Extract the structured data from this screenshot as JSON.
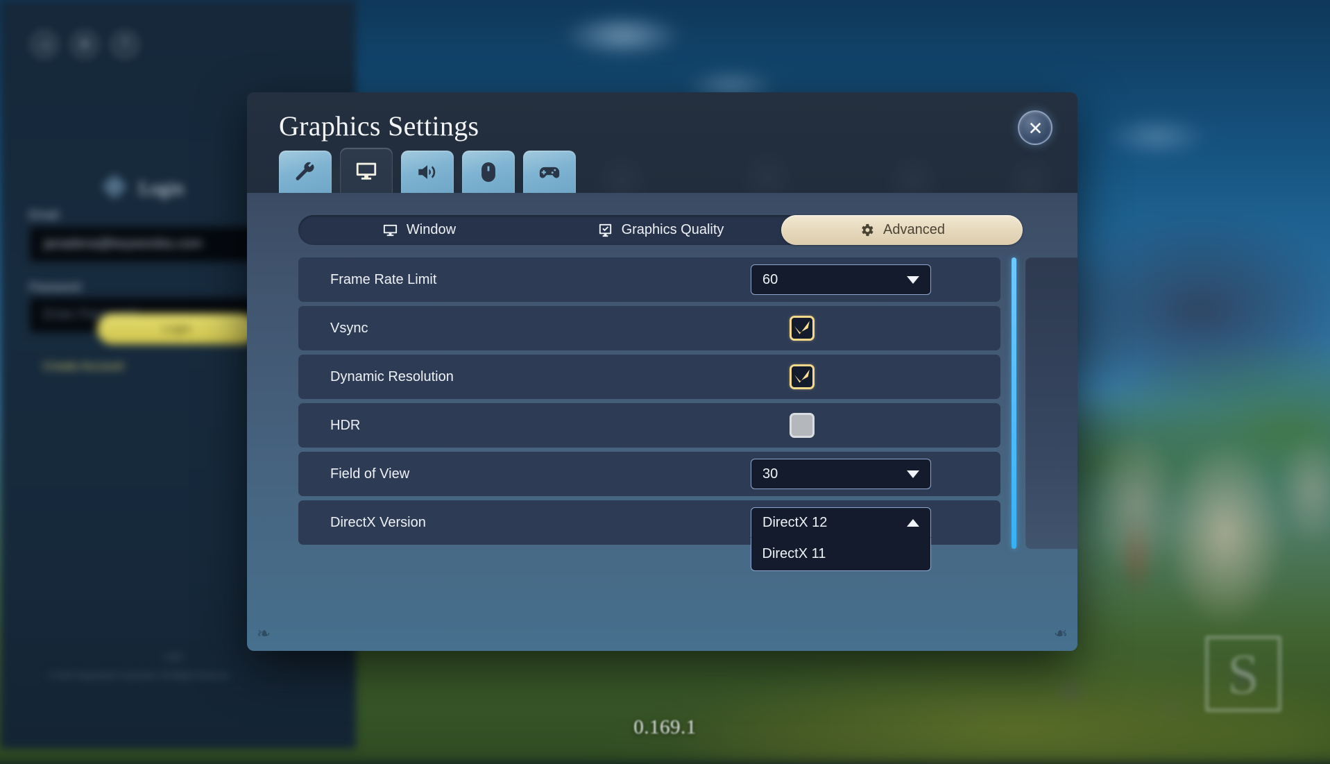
{
  "background": {
    "version_label": "0.169.1",
    "watermark_letter": "S",
    "top_icons": [
      {
        "name": "share-icon",
        "glyph": "◁"
      },
      {
        "name": "settings-gear-icon",
        "glyph": "⚙"
      },
      {
        "name": "help-icon",
        "glyph": "?"
      }
    ],
    "login": {
      "title": "Login",
      "email_label": "Email",
      "email_value": "janadena@keywordss.com",
      "password_label": "Password",
      "password_placeholder": "Enter Password",
      "login_button": "Login",
      "create_account_link": "Create Account",
      "legal_line_1": "Legal",
      "legal_line_2": "© 2025 Singularity6 Corporation. All Rights Reserved."
    }
  },
  "dialog": {
    "title": "Graphics Settings",
    "close_label": "Close",
    "icon_tabs": [
      {
        "name": "general-settings-tab",
        "icon": "wrench-icon",
        "active": false
      },
      {
        "name": "graphics-settings-tab",
        "icon": "monitor-icon",
        "active": true
      },
      {
        "name": "audio-settings-tab",
        "icon": "speaker-icon",
        "active": false
      },
      {
        "name": "controls-settings-tab",
        "icon": "mouse-icon",
        "active": false
      },
      {
        "name": "gamepad-settings-tab",
        "icon": "gamepad-icon",
        "active": false
      }
    ],
    "subtabs": [
      {
        "label": "Window",
        "icon": "monitor-icon",
        "active": false
      },
      {
        "label": "Graphics Quality",
        "icon": "checked-monitor-icon",
        "active": false
      },
      {
        "label": "Advanced",
        "icon": "gear-icon",
        "active": true
      }
    ],
    "settings": [
      {
        "label": "Frame Rate Limit",
        "control": "dropdown",
        "value": "60",
        "open": false,
        "options": []
      },
      {
        "label": "Vsync",
        "control": "checkbox",
        "checked": true
      },
      {
        "label": "Dynamic Resolution",
        "control": "checkbox",
        "checked": true
      },
      {
        "label": "HDR",
        "control": "checkbox",
        "checked": false
      },
      {
        "label": "Field of View",
        "control": "dropdown",
        "value": "30",
        "open": false,
        "options": []
      },
      {
        "label": "DirectX Version",
        "control": "dropdown",
        "value": "DirectX 12",
        "open": true,
        "options": [
          "DirectX 11"
        ]
      }
    ],
    "colors": {
      "accent_gold": "#f4d98a",
      "active_tab_cream": "#e6d9bd",
      "scrollbar_blue": "#4fbcf7",
      "row_background": "#2e3b55",
      "dropdown_background": "#131b2c",
      "dropdown_border": "#8fa7cf"
    }
  }
}
